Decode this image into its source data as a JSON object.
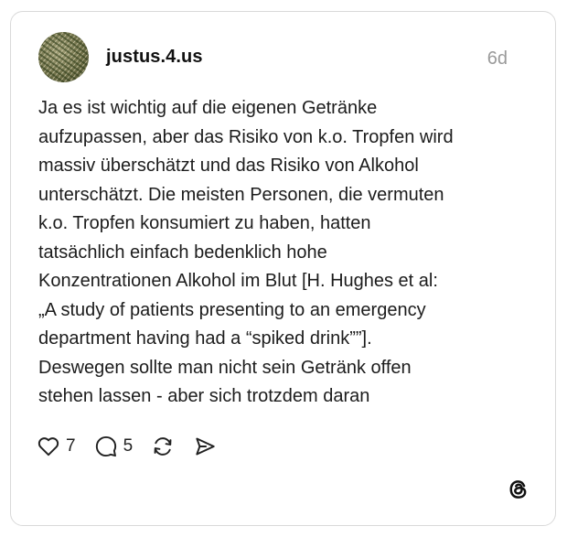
{
  "post": {
    "author": "justus.4.us",
    "time": "6d",
    "text": "Ja es ist wichtig auf die eigenen Getränke\naufzupassen, aber das Risiko von k.o. Tropfen wird\nmassiv überschätzt und das Risiko von Alkohol\nunterschätzt. Die meisten Personen, die vermuten\nk.o. Tropfen konsumiert zu haben, hatten\ntatsächlich einfach bedenklich hohe\nKonzentrationen Alkohol im Blut [H. Hughes et al:\n„A study of patients presenting to an emergency\ndepartment having had a “spiked drink””].\nDeswegen sollte man nicht sein Getränk offen\nstehen lassen - aber sich trotzdem daran"
  },
  "actions": {
    "likes": "7",
    "replies": "5"
  },
  "icons": {
    "like": "heart-icon",
    "reply": "comment-bubble-icon",
    "repost": "repost-icon",
    "share": "send-icon",
    "brand": "threads-logo-icon"
  },
  "colors": {
    "text": "#1c1c1c",
    "muted": "#9a9a9a",
    "border": "#d9d9d9"
  }
}
